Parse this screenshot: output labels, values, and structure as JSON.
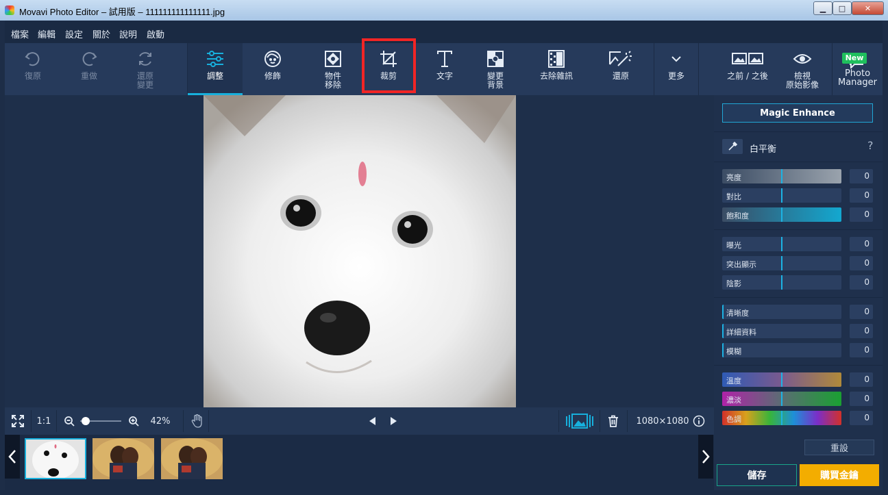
{
  "window": {
    "title": "Movavi Photo Editor – 試用版 – 111111111111111.jpg",
    "minimize": "▁",
    "maximize": "□",
    "close": "✕"
  },
  "menu": [
    "檔案",
    "編輯",
    "設定",
    "關於",
    "說明",
    "啟動"
  ],
  "toolbar": {
    "undo": "復原",
    "redo": "重做",
    "revert": "還原\n變更",
    "adjust": "調整",
    "retouch": "修飾",
    "object_removal": "物件\n移除",
    "crop": "裁剪",
    "text": "文字",
    "change_background": "變更\n背景",
    "denoise": "去除雜訊",
    "restore": "還原",
    "more": "更多",
    "before_after": "之前 / 之後",
    "view_original": "檢視\n原始影像",
    "photo_manager": "Photo\nManager",
    "new_badge": "New"
  },
  "bottombar": {
    "one_to_one": "1:1",
    "zoom": "42%",
    "image_size": "1080×1080"
  },
  "panel": {
    "magic_enhance": "Magic Enhance",
    "white_balance": "白平衡",
    "help": "?",
    "sliders": [
      {
        "label": "亮度",
        "value": "0"
      },
      {
        "label": "對比",
        "value": "0"
      },
      {
        "label": "飽和度",
        "value": "0"
      },
      {
        "label": "曝光",
        "value": "0"
      },
      {
        "label": "突出顯示",
        "value": "0"
      },
      {
        "label": "陰影",
        "value": "0"
      },
      {
        "label": "清晰度",
        "value": "0"
      },
      {
        "label": "詳細資料",
        "value": "0"
      },
      {
        "label": "模糊",
        "value": "0"
      },
      {
        "label": "溫度",
        "value": "0"
      },
      {
        "label": "濃淡",
        "value": "0"
      },
      {
        "label": "色調",
        "value": "0"
      }
    ],
    "reset": "重設",
    "save": "儲存",
    "buy": "購買金鑰"
  },
  "colors": {
    "accent": "#17b0dd",
    "buy": "#f3ad00",
    "highlight": "#f22525",
    "new_badge": "#1fbf5d"
  }
}
